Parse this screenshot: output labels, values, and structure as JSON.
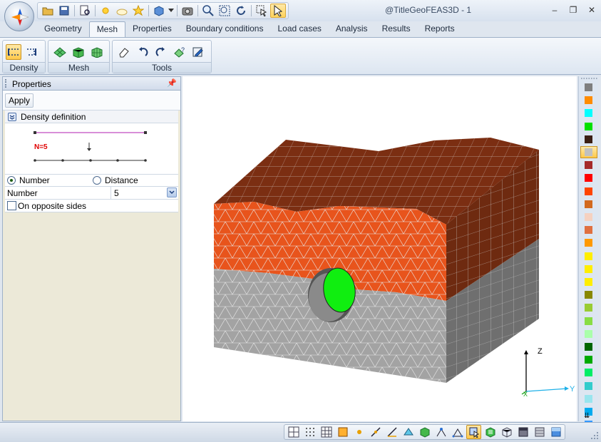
{
  "window": {
    "title": "@TitleGeoFEAS3D - 1",
    "minimize": "–",
    "restore": "❐",
    "close": "✕"
  },
  "tabs": [
    {
      "label": "Geometry",
      "active": false
    },
    {
      "label": "Mesh",
      "active": true
    },
    {
      "label": "Properties",
      "active": false
    },
    {
      "label": "Boundary conditions",
      "active": false
    },
    {
      "label": "Load cases",
      "active": false
    },
    {
      "label": "Analysis",
      "active": false
    },
    {
      "label": "Results",
      "active": false
    },
    {
      "label": "Reports",
      "active": false
    }
  ],
  "ribbon": {
    "groups": [
      {
        "label": "Density"
      },
      {
        "label": "Mesh"
      },
      {
        "label": "Tools"
      }
    ]
  },
  "panel": {
    "title": "Properties",
    "apply_label": "Apply",
    "section_title": "Density definition",
    "diagram_label": "N=5",
    "radio_number": "Number",
    "radio_distance": "Distance",
    "selected_mode": "Number",
    "number_label": "Number",
    "number_value": "5",
    "opposite_label": "On opposite sides",
    "opposite_checked": false
  },
  "axes": {
    "z": "Z",
    "y": "Y",
    "x": "X"
  },
  "colors": {
    "accent": "#ffc84a",
    "top_soil": "#7b2e12",
    "middle_layer": "#e8541c",
    "bottom_layer": "#9e9e9e",
    "tunnel_face": "#10ee10"
  },
  "palette": [
    "#7f7f7f",
    "#ff8c00",
    "#00ffff",
    "#00e000",
    "#3b1f14",
    "#c0c0c0",
    "#a52a2a",
    "#ff0000",
    "#ff4500",
    "#d2691e",
    "#f5d1c0",
    "#e07040",
    "#ff9900",
    "#ffee00",
    "#ffee00",
    "#ffee00",
    "#888800",
    "#99cc33",
    "#88dd44",
    "#aaffaa",
    "#006600",
    "#00aa00",
    "#00ee66",
    "#33cccc",
    "#99e5ee",
    "#00aaee",
    "#3399ff"
  ],
  "palette_selected_index": 5
}
